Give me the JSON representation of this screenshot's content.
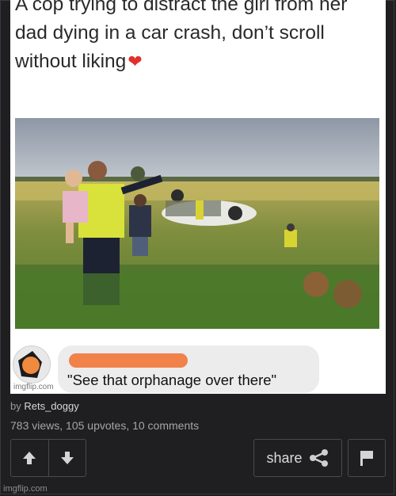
{
  "meme": {
    "caption_line1": "A cop trying to distract the girl from her",
    "caption_line2": "dad dying in a car crash, don’t scroll",
    "caption_line3": "without liking",
    "heart": "❤",
    "comment_text": "\"See that orphanage over there\"",
    "watermark": "imgflip.com"
  },
  "post": {
    "by_prefix": "by ",
    "username": "Rets_doggy",
    "stats": "783 views, 105 upvotes, 10 comments",
    "share_label": "share"
  },
  "footer": {
    "watermark": "imgflip.com"
  },
  "icons": {
    "upvote": "arrow-up-icon",
    "downvote": "arrow-down-icon",
    "share": "share-nodes-icon",
    "flag": "flag-icon"
  },
  "colors": {
    "background": "#1f1f21",
    "heart": "#e0302a",
    "redaction": "#f0824a",
    "button_border": "#4a4a4d"
  }
}
